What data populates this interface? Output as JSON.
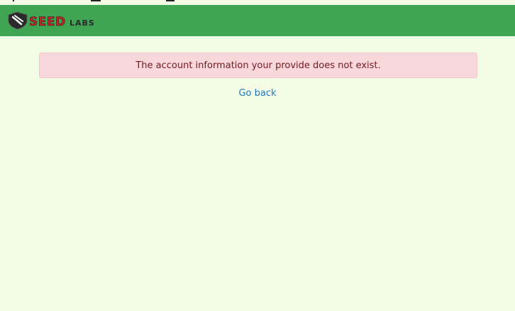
{
  "header": {
    "logo_text": "SEEDLABS",
    "background_color": "#3fa553"
  },
  "alert": {
    "message": "The account information your provide does not exist.",
    "color": "#f8d7da"
  },
  "back_link": {
    "label": "Go back"
  }
}
